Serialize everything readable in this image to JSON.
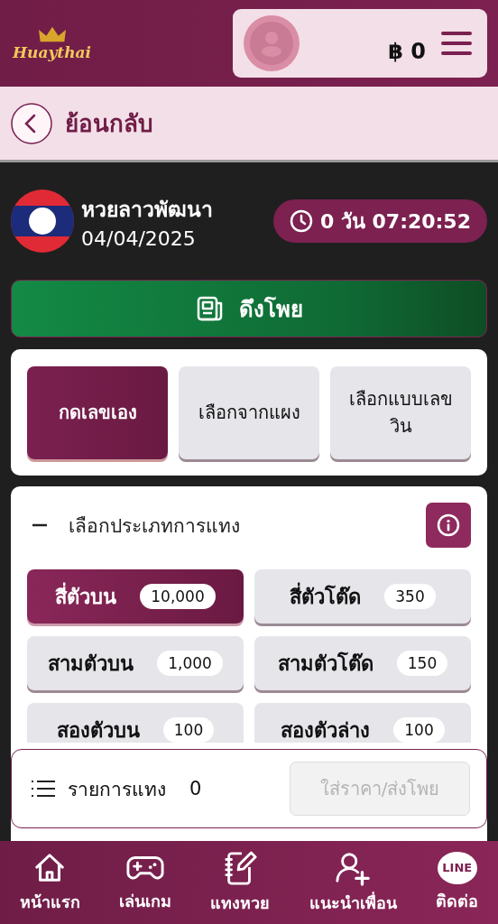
{
  "header": {
    "logo_text": "Huaythai",
    "balance": "฿ 0"
  },
  "back": {
    "label": "ย้อนกลับ"
  },
  "lottery": {
    "name": "หวยลาวพัฒนา",
    "date": "04/04/2025",
    "countdown": "0 วัน 07:20:52"
  },
  "pull_button": {
    "label": "ดึงโพย"
  },
  "mode_tabs": [
    {
      "label": "กดเลขเอง",
      "selected": true
    },
    {
      "label": "เลือกจากแผง",
      "selected": false
    },
    {
      "label": "เลือกแบบเลขวิน",
      "selected": false
    }
  ],
  "bet_types": {
    "title": "เลือกประเภทการแทง",
    "expanded": true,
    "items": [
      {
        "label": "สี่ตัวบน",
        "rate": "10,000",
        "selected": true
      },
      {
        "label": "สี่ตัวโต๊ด",
        "rate": "350",
        "selected": false
      },
      {
        "label": "สามตัวบน",
        "rate": "1,000",
        "selected": false
      },
      {
        "label": "สามตัวโต๊ด",
        "rate": "150",
        "selected": false
      },
      {
        "label": "สองตัวบน",
        "rate": "100",
        "selected": false
      },
      {
        "label": "สองตัวล่าง",
        "rate": "100",
        "selected": false
      }
    ]
  },
  "bet_bar": {
    "label": "รายการแทง",
    "count": "0",
    "submit": {
      "label": "ใส่ราคา/ส่งโพย",
      "disabled": true
    }
  },
  "bottom_nav": [
    {
      "kind": "home",
      "label": "หน้าแรก"
    },
    {
      "kind": "game",
      "label": "เล่นเกม"
    },
    {
      "kind": "notebook",
      "label": "แทงหวย"
    },
    {
      "kind": "invite",
      "label": "แนะนำเพื่อน"
    },
    {
      "kind": "line",
      "label": "ติดต่อ",
      "icon_text": "LINE"
    }
  ]
}
